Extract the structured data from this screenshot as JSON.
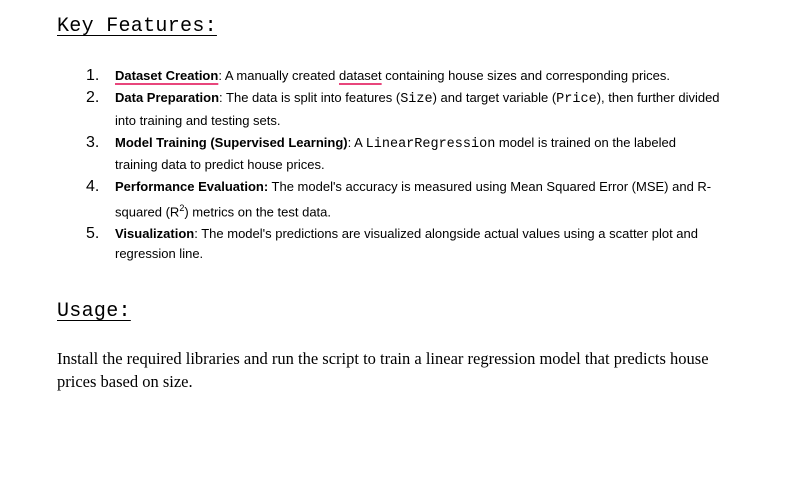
{
  "key_features": {
    "heading": "Key Features:",
    "items": [
      {
        "num": "1.",
        "title": "Dataset Creation",
        "t1": ": A manually created ",
        "t2": "dataset",
        "t3": " containing house sizes and corresponding prices."
      },
      {
        "num": "2.",
        "title": "Data Preparation",
        "t1": ": The data is split into features (",
        "c1": "Size",
        "t2": ") and target variable (",
        "c2": "Price",
        "t3": "), then further divided into training and testing sets."
      },
      {
        "num": "3.",
        "title": "Model Training (Supervised Learning)",
        "t1": ": A ",
        "c1": "LinearRegression",
        "t2": " model is trained on the labeled training data to predict house prices."
      },
      {
        "num": "4.",
        "title": "Performance Evaluation:",
        "t1": " The model's accuracy is measured using Mean Squared Error (MSE) and R-squared (R",
        "sup": "2",
        "t2": ") metrics on the test data."
      },
      {
        "num": "5.",
        "title": "Visualization",
        "t1": ": The model's predictions are visualized alongside actual values using a scatter plot and regression line."
      }
    ]
  },
  "usage": {
    "heading": "Usage:",
    "text": "Install the required libraries and run the script to train a linear regression model that predicts house prices based on size."
  }
}
